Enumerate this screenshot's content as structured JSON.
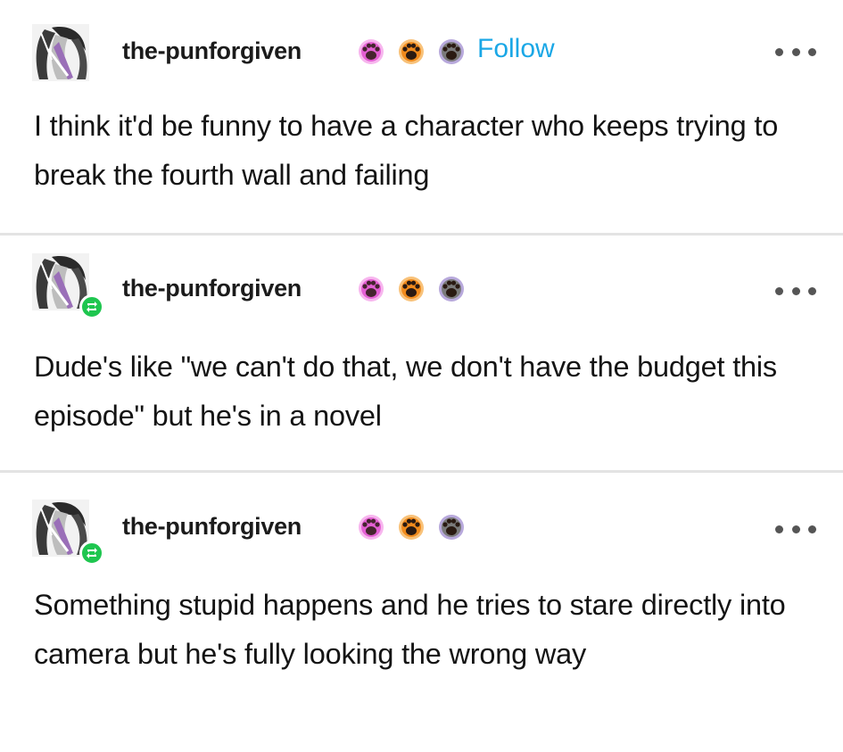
{
  "posts": [
    {
      "username": "the-punforgiven",
      "follow_label": "Follow",
      "text": "I think it'd be funny to have a character who keeps trying to break the fourth wall and failing"
    },
    {
      "username": "the-punforgiven",
      "text": "Dude's like \"we can't do that, we don't have the budget this episode\" but he's in a novel"
    },
    {
      "username": "the-punforgiven",
      "text": "Something stupid happens and he tries to stare directly into camera but he's fully looking the wrong way"
    }
  ],
  "colors": {
    "follow_blue": "#1aa7e6",
    "reblog_green": "#1ec64f",
    "badge_pink": "#e35fd3",
    "badge_orange": "#f08a1c",
    "badge_purple": "#7a5fb8"
  },
  "icons": [
    "avatar",
    "pink-paw-badge-icon",
    "orange-paw-badge-icon",
    "gray-paw-badge-icon",
    "reblog-icon",
    "more-options-icon"
  ]
}
